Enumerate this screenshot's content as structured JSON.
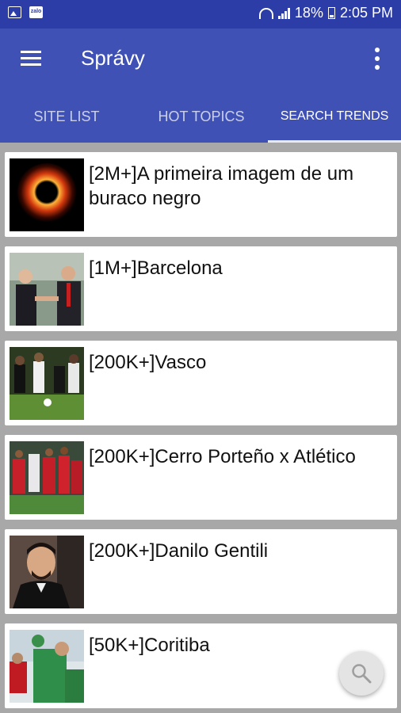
{
  "status_bar": {
    "battery": "18%",
    "time": "2:05 PM",
    "app_icon": "zalo"
  },
  "app_bar": {
    "title": "Správy"
  },
  "tabs": [
    {
      "label": "SITE LIST"
    },
    {
      "label": "HOT TOPICS"
    },
    {
      "label": "SEARCH TRENDS"
    }
  ],
  "trends": [
    {
      "title": "[2M+]A primeira imagem de um buraco negro"
    },
    {
      "title": "[1M+]Barcelona"
    },
    {
      "title": "[200K+]Vasco"
    },
    {
      "title": "[200K+]Cerro Porteño x Atlético"
    },
    {
      "title": "[200K+]Danilo Gentili"
    },
    {
      "title": "[50K+]Coritiba"
    }
  ],
  "colors": {
    "status_bar": "#2d3da8",
    "app_bar": "#3f51b5",
    "background": "#a8a8a8"
  }
}
